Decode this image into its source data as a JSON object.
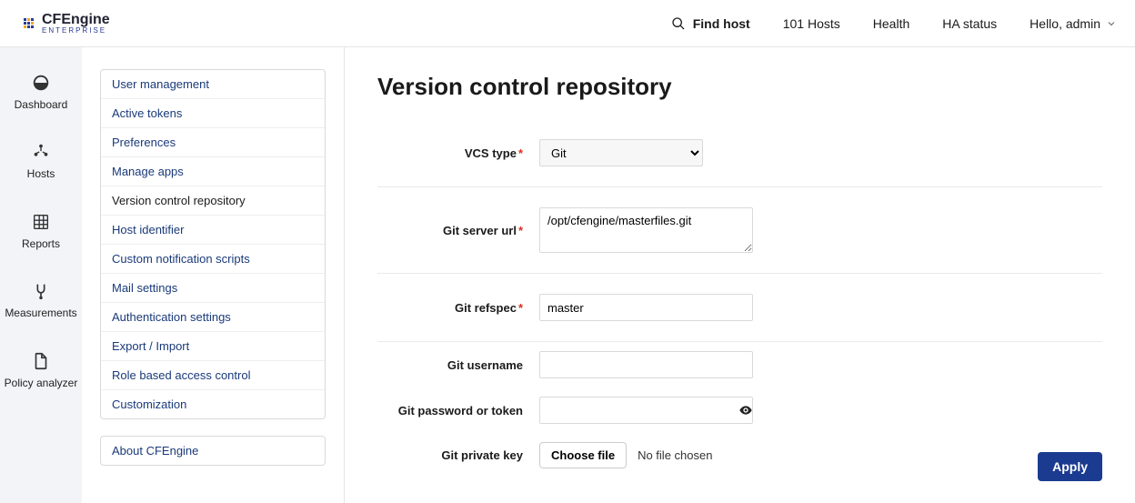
{
  "header": {
    "logo_title": "CFEngine",
    "logo_sub": "ENTERPRISE",
    "find_host": "Find host",
    "nav": {
      "hosts": "101 Hosts",
      "health": "Health",
      "ha_status": "HA status"
    },
    "user_greeting": "Hello, admin"
  },
  "sidebar1": {
    "items": [
      {
        "label": "Dashboard"
      },
      {
        "label": "Hosts"
      },
      {
        "label": "Reports"
      },
      {
        "label": "Measurements"
      },
      {
        "label": "Policy analyzer"
      }
    ]
  },
  "sidebar2": {
    "items": [
      {
        "label": "User management"
      },
      {
        "label": "Active tokens"
      },
      {
        "label": "Preferences"
      },
      {
        "label": "Manage apps"
      },
      {
        "label": "Version control repository"
      },
      {
        "label": "Host identifier"
      },
      {
        "label": "Custom notification scripts"
      },
      {
        "label": "Mail settings"
      },
      {
        "label": "Authentication settings"
      },
      {
        "label": "Export / Import"
      },
      {
        "label": "Role based access control"
      },
      {
        "label": "Customization"
      }
    ],
    "about": "About CFEngine"
  },
  "page": {
    "title": "Version control repository",
    "labels": {
      "vcs_type": "VCS type",
      "git_server_url": "Git server url",
      "git_refspec": "Git refspec",
      "git_username": "Git username",
      "git_password": "Git password or token",
      "git_private_key": "Git private key"
    },
    "values": {
      "vcs_type": "Git",
      "git_server_url": "/opt/cfengine/masterfiles.git",
      "git_refspec": "master",
      "git_username": "",
      "git_password": ""
    },
    "file": {
      "choose_label": "Choose file",
      "status": "No file chosen"
    },
    "apply_label": "Apply"
  }
}
